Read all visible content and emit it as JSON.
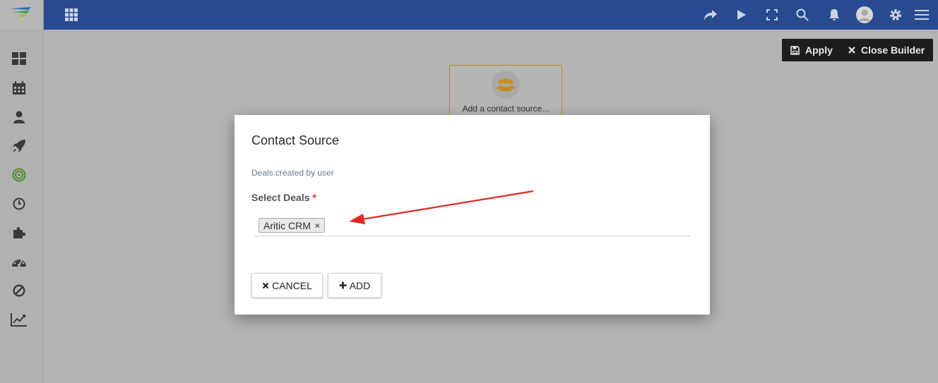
{
  "header": {
    "icons": [
      "apps-grid-icon",
      "share-icon",
      "play-icon",
      "fullscreen-icon",
      "search-icon",
      "bell-icon",
      "user-avatar-icon",
      "gear-icon",
      "hamburger-menu-icon"
    ]
  },
  "sidebar": {
    "icons": [
      "dashboard-icon",
      "calendar-icon",
      "user-icon",
      "rocket-icon",
      "target-icon",
      "clock-icon",
      "puzzle-icon",
      "speedometer-icon",
      "ban-icon",
      "chart-line-icon"
    ]
  },
  "builder": {
    "apply_label": "Apply",
    "close_label": "Close Builder",
    "source_card_label": "Add a contact source..."
  },
  "modal": {
    "title": "Contact Source",
    "subtitle": "Deals created by user",
    "field_label": "Select Deals",
    "required_mark": "*",
    "selected_chip": "Aritic CRM",
    "chip_remove": "×",
    "cancel_label": "CANCEL",
    "add_label": "ADD"
  },
  "colors": {
    "header_bg": "#284b90",
    "overlay_bg": "#b4b4b4",
    "required": "#d9282a",
    "annotation_arrow": "#e02a27"
  }
}
